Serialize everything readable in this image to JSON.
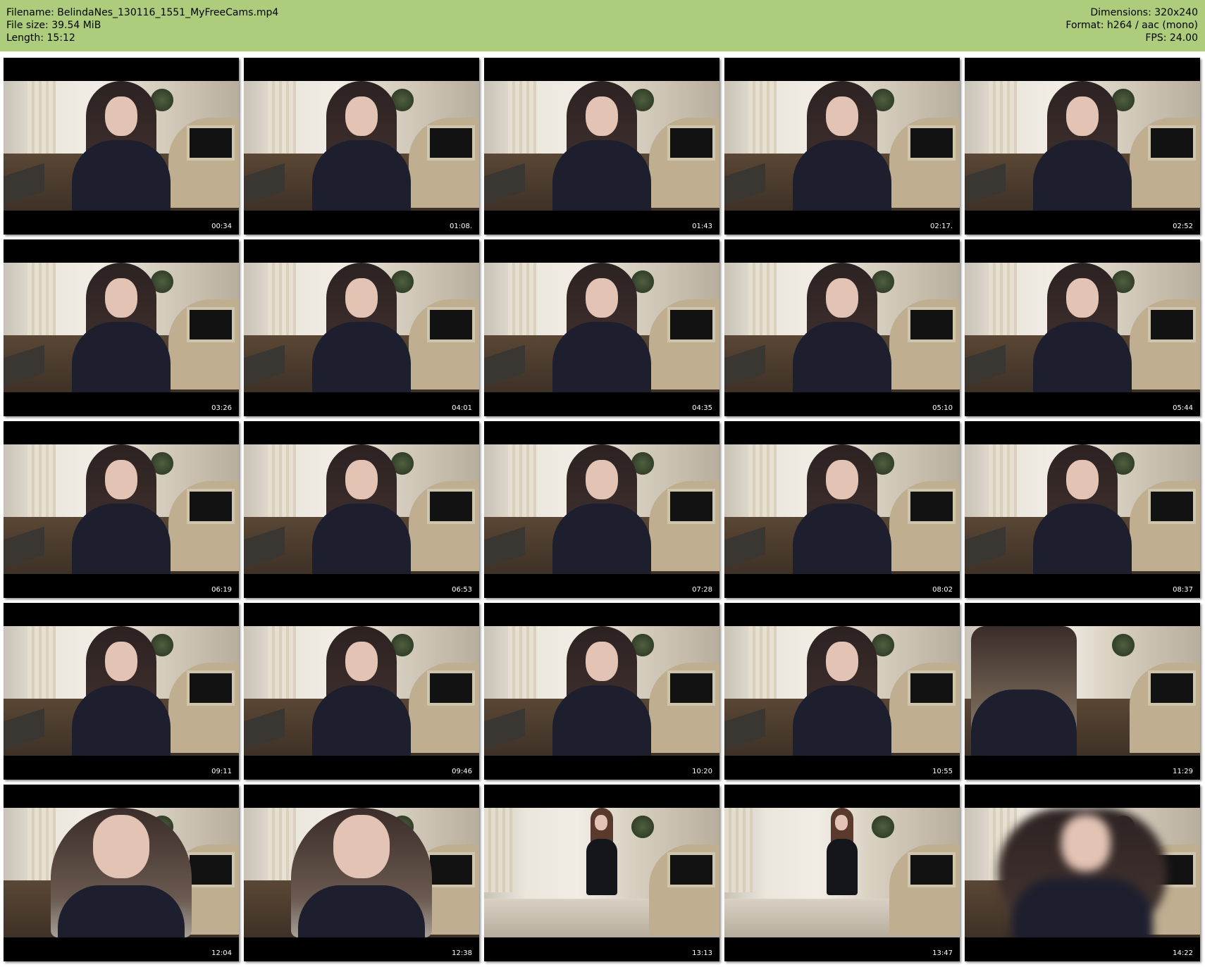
{
  "header": {
    "filename": "Filename: BelindaNes_130116_1551_MyFreeCams.mp4",
    "file_size": "File size: 39.54 MiB",
    "length": "Length: 15:12",
    "dimensions": "Dimensions: 320x240",
    "format": "Format: h264 / aac (mono)",
    "fps": "FPS: 24.00"
  },
  "thumbnails": [
    {
      "time": "00:34",
      "variant": "seated"
    },
    {
      "time": "01:08.",
      "variant": "seated"
    },
    {
      "time": "01:43",
      "variant": "seated"
    },
    {
      "time": "02:17.",
      "variant": "seated"
    },
    {
      "time": "02:52",
      "variant": "seated"
    },
    {
      "time": "03:26",
      "variant": "seated"
    },
    {
      "time": "04:01",
      "variant": "seated"
    },
    {
      "time": "04:35",
      "variant": "seated"
    },
    {
      "time": "05:10",
      "variant": "seated"
    },
    {
      "time": "05:44",
      "variant": "seated"
    },
    {
      "time": "06:19",
      "variant": "seated"
    },
    {
      "time": "06:53",
      "variant": "seated"
    },
    {
      "time": "07:28",
      "variant": "seated"
    },
    {
      "time": "08:02",
      "variant": "seated"
    },
    {
      "time": "08:37",
      "variant": "seated"
    },
    {
      "time": "09:11",
      "variant": "seated"
    },
    {
      "time": "09:46",
      "variant": "seated"
    },
    {
      "time": "10:20",
      "variant": "seated"
    },
    {
      "time": "10:55",
      "variant": "seated"
    },
    {
      "time": "11:29",
      "variant": "back"
    },
    {
      "time": "12:04",
      "variant": "close"
    },
    {
      "time": "12:38",
      "variant": "close"
    },
    {
      "time": "13:13",
      "variant": "standing"
    },
    {
      "time": "13:47",
      "variant": "standing"
    },
    {
      "time": "14:22",
      "variant": "blur"
    }
  ],
  "colors": {
    "header_bg": "#adcc7c",
    "thumb_bg": "#000000",
    "timestamp": "#ffffff"
  }
}
